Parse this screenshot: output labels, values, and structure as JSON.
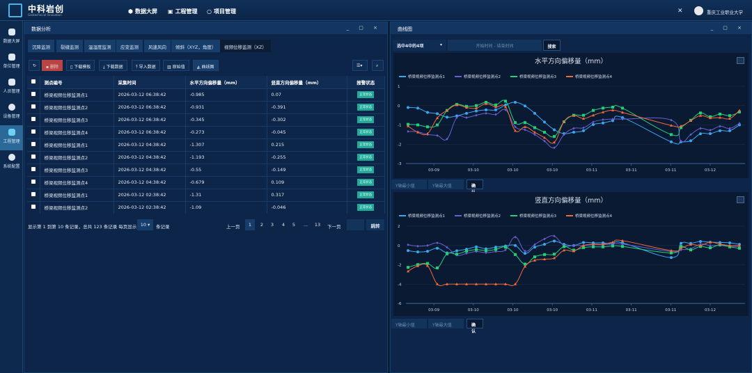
{
  "header": {
    "brand": "中科岩创",
    "brand_sub": "Geotechnical Innovation",
    "nav": [
      {
        "label": "数据大屏",
        "icon": "cube-icon"
      },
      {
        "label": "工程管理",
        "icon": "monitor-icon"
      },
      {
        "label": "项目管理",
        "icon": "circle-icon"
      }
    ],
    "user": "重庆工业职业大学"
  },
  "sidebar": {
    "items": [
      {
        "label": "数据大屏"
      },
      {
        "label": "单位管理"
      },
      {
        "label": "人员管理"
      },
      {
        "label": "设备管理"
      },
      {
        "label": "工程管理",
        "active": true
      },
      {
        "label": "系统配置"
      }
    ]
  },
  "left": {
    "title": "数据分析",
    "tabs": [
      "沉降监测",
      "裂缝监测",
      "温湿度监测",
      "应变监测",
      "风速风向",
      "倾斜（XYZ，角度）",
      "视频位移监测（XZ）"
    ],
    "toolbar": {
      "delete": "删除",
      "template": "下载模板",
      "download": "下载数据",
      "import": "导入数据",
      "raw": "原始值",
      "curve": "曲线图"
    },
    "columns": [
      "测点编号",
      "采集时间",
      "水平方向偏移量（mm）",
      "竖直方向偏移量（mm）",
      "报警状态"
    ],
    "rows": [
      [
        "桥梁视频位移监测点1",
        "2026-03-12 06:38:42",
        "-0.985",
        "0.07",
        "正常状态"
      ],
      [
        "桥梁视频位移监测点2",
        "2026-03-12 06:38:42",
        "-0.931",
        "-0.391",
        "正常状态"
      ],
      [
        "桥梁视频位移监测点3",
        "2026-03-12 06:38:42",
        "-0.345",
        "-0.302",
        "正常状态"
      ],
      [
        "桥梁视频位移监测点4",
        "2026-03-12 06:38:42",
        "-0.273",
        "-0.045",
        "正常状态"
      ],
      [
        "桥梁视频位移监测点1",
        "2026-03-12 04:38:42",
        "-1.307",
        "0.215",
        "正常状态"
      ],
      [
        "桥梁视频位移监测点2",
        "2026-03-12 04:38:42",
        "-1.193",
        "-0.255",
        "正常状态"
      ],
      [
        "桥梁视频位移监测点3",
        "2026-03-12 04:38:42",
        "-0.55",
        "-0.149",
        "正常状态"
      ],
      [
        "桥梁视频位移监测点4",
        "2026-03-12 04:38:42",
        "-0.679",
        "0.109",
        "正常状态"
      ],
      [
        "桥梁视频位移监测点1",
        "2026-03-12 02:38:42",
        "-1.31",
        "0.317",
        "正常状态"
      ],
      [
        "桥梁视频位移监测点2",
        "2026-03-12 02:38:42",
        "-1.09",
        "-0.046",
        "正常状态"
      ]
    ],
    "pagination": {
      "summary_a": "显示第 1 到第 10 条记录，总共 123 条记录 每页显示",
      "page_size": "10",
      "summary_b": "条记录",
      "prev": "上一页",
      "pages": [
        "1",
        "2",
        "3",
        "4",
        "5",
        "...",
        "13"
      ],
      "current": "1",
      "next": "下一页",
      "jump": "跳转"
    }
  },
  "right": {
    "title": "曲线图",
    "select": "选中4中的4项",
    "date_placeholder": "开始时间 - 结束时间",
    "search": "搜索",
    "ymin_placeholder": "Y轴最小值",
    "ymax_placeholder": "Y轴最大值",
    "confirm": "确认"
  },
  "chart_data": [
    {
      "type": "line",
      "title": "水平方向偏移量（mm）",
      "ylim": [
        -3,
        1
      ],
      "yticks": [
        1,
        0,
        -1,
        -2,
        -3
      ],
      "xtick_labels": [
        "03-09",
        "03-10",
        "03-10",
        "03-10",
        "03-11",
        "03-11",
        "03-11",
        "03-12"
      ],
      "legend": "top-left",
      "grid": true,
      "series": [
        {
          "name": "桥梁视频位移监测点1",
          "color": "#3ba6f0",
          "marker": "circle",
          "values": [
            -0.1,
            -0.13,
            -0.35,
            -0.42,
            -0.6,
            -0.53,
            -0.4,
            -0.28,
            -0.22,
            -0.22,
            0.03,
            0.17,
            -0.02,
            -0.4,
            -0.85,
            -1.25,
            -1.45,
            -1.38,
            -1.3,
            -0.98,
            -0.9,
            -0.78,
            -0.62,
            null,
            null,
            null,
            null,
            -1.88,
            -1.88,
            -1.82,
            -1.46,
            -1.45,
            -1.3,
            -1.3,
            -1.0
          ]
        },
        {
          "name": "桥梁视频位移监测点2",
          "color": "#6a5fd0",
          "marker": "diamond",
          "values": [
            -1.34,
            -1.36,
            -1.5,
            -1.55,
            -1.73,
            -0.62,
            -0.62,
            -0.5,
            -0.4,
            -0.46,
            -0.22,
            -1.1,
            -1.25,
            -1.5,
            -1.84,
            -2.18,
            -1.5,
            -1.18,
            -1.15,
            -0.85,
            -0.73,
            -0.7,
            -0.7,
            null,
            null,
            null,
            null,
            -0.75,
            -1.84,
            -1.5,
            -1.18,
            -1.27,
            -1.07,
            -1.18,
            -0.92
          ]
        },
        {
          "name": "桥梁视频位移监测点3",
          "color": "#22d07a",
          "marker": "square",
          "values": [
            -0.97,
            -1.0,
            -1.1,
            -1.0,
            -0.25,
            0.06,
            -0.04,
            0,
            0.17,
            0.03,
            0.23,
            -0.88,
            -0.88,
            -1.14,
            -1.38,
            -1.6,
            -0.84,
            -0.5,
            -0.5,
            -0.25,
            -0.13,
            -0.08,
            -0.13,
            null,
            null,
            null,
            null,
            -1.5,
            -1.14,
            -0.76,
            -0.38,
            -0.58,
            -0.44,
            -0.52,
            -0.33
          ]
        },
        {
          "name": "桥梁视频位移监测点4",
          "color": "#f06a3a",
          "marker": "triangle",
          "values": [
            -1.06,
            -1.38,
            -1.45,
            -0.64,
            -0.25,
            0.03,
            -0.1,
            -0.13,
            0.1,
            -0.07,
            -0.07,
            -1.3,
            -1.1,
            -1.38,
            -1.66,
            -1.9,
            -0.83,
            -0.52,
            -0.67,
            -0.5,
            -0.34,
            -0.24,
            -0.35,
            null,
            null,
            null,
            null,
            -1.03,
            -1.06,
            -0.78,
            -0.52,
            -0.64,
            -0.62,
            -0.67,
            -0.25
          ]
        }
      ]
    },
    {
      "type": "line",
      "title": "竖直方向偏移量（mm）",
      "ylim": [
        -6,
        2
      ],
      "yticks": [
        2,
        0,
        -2,
        -4,
        -6
      ],
      "xtick_labels": [
        "03-09",
        "03-10",
        "03-10",
        "03-10",
        "03-11",
        "03-11",
        "03-11",
        "03-12"
      ],
      "legend": "top-left",
      "grid": true,
      "series": [
        {
          "name": "桥梁视频位移监测点1",
          "color": "#3ba6f0",
          "marker": "circle",
          "values": [
            -0.53,
            -0.67,
            -0.6,
            -0.29,
            -0.77,
            -0.55,
            -0.39,
            -0.14,
            -0.34,
            -0.17,
            -0.05,
            0,
            -0.82,
            -0.17,
            0.12,
            0.46,
            0.12,
            0,
            0.31,
            0.27,
            0.27,
            0.19,
            0.27,
            null,
            null,
            null,
            null,
            -1.25,
            0.22,
            0.22,
            0.41,
            0.34,
            0.31,
            0.27,
            0.12
          ]
        },
        {
          "name": "桥梁视频位移监测点2",
          "color": "#6a5fd0",
          "marker": "diamond",
          "values": [
            0.07,
            -0.07,
            0,
            0.27,
            -0.19,
            -1.0,
            -0.82,
            -0.63,
            -0.75,
            -0.63,
            -0.46,
            0.87,
            -0.58,
            0.1,
            0.68,
            0.97,
            0,
            0,
            0,
            0.07,
            0.07,
            0.14,
            0.14,
            null,
            null,
            null,
            null,
            -0.63,
            -0.46,
            -0.34,
            0.14,
            0,
            0,
            -0.1,
            -0.1
          ]
        },
        {
          "name": "桥梁视频位移监测点3",
          "color": "#22d07a",
          "marker": "square",
          "values": [
            -2.27,
            -1.98,
            -1.86,
            -2.32,
            -0.87,
            -0.9,
            -0.58,
            -0.43,
            -0.53,
            -0.41,
            -0.17,
            -0.94,
            -1.93,
            -1.18,
            -0.94,
            -0.9,
            -0.12,
            -0.48,
            -0.22,
            -0.14,
            -0.14,
            -0.05,
            -0.1,
            null,
            null,
            null,
            null,
            -0.77,
            -0.1,
            -0.46,
            -0.1,
            -0.24,
            0.07,
            -0.14,
            -0.29
          ]
        },
        {
          "name": "桥梁视频位移监测点4",
          "color": "#f06a3a",
          "marker": "triangle",
          "values": [
            -2.67,
            -2.12,
            -2.1,
            -4,
            -4,
            -4,
            -4,
            -4,
            -4,
            -4,
            -4,
            -4,
            -2.17,
            -1.54,
            -1.42,
            -1.3,
            -0.5,
            -0.58,
            0,
            0.14,
            0.14,
            0.34,
            0.5,
            null,
            null,
            null,
            null,
            -0.53,
            -0.29,
            0.1,
            0,
            0.34,
            0.14,
            0,
            0
          ]
        }
      ]
    }
  ]
}
